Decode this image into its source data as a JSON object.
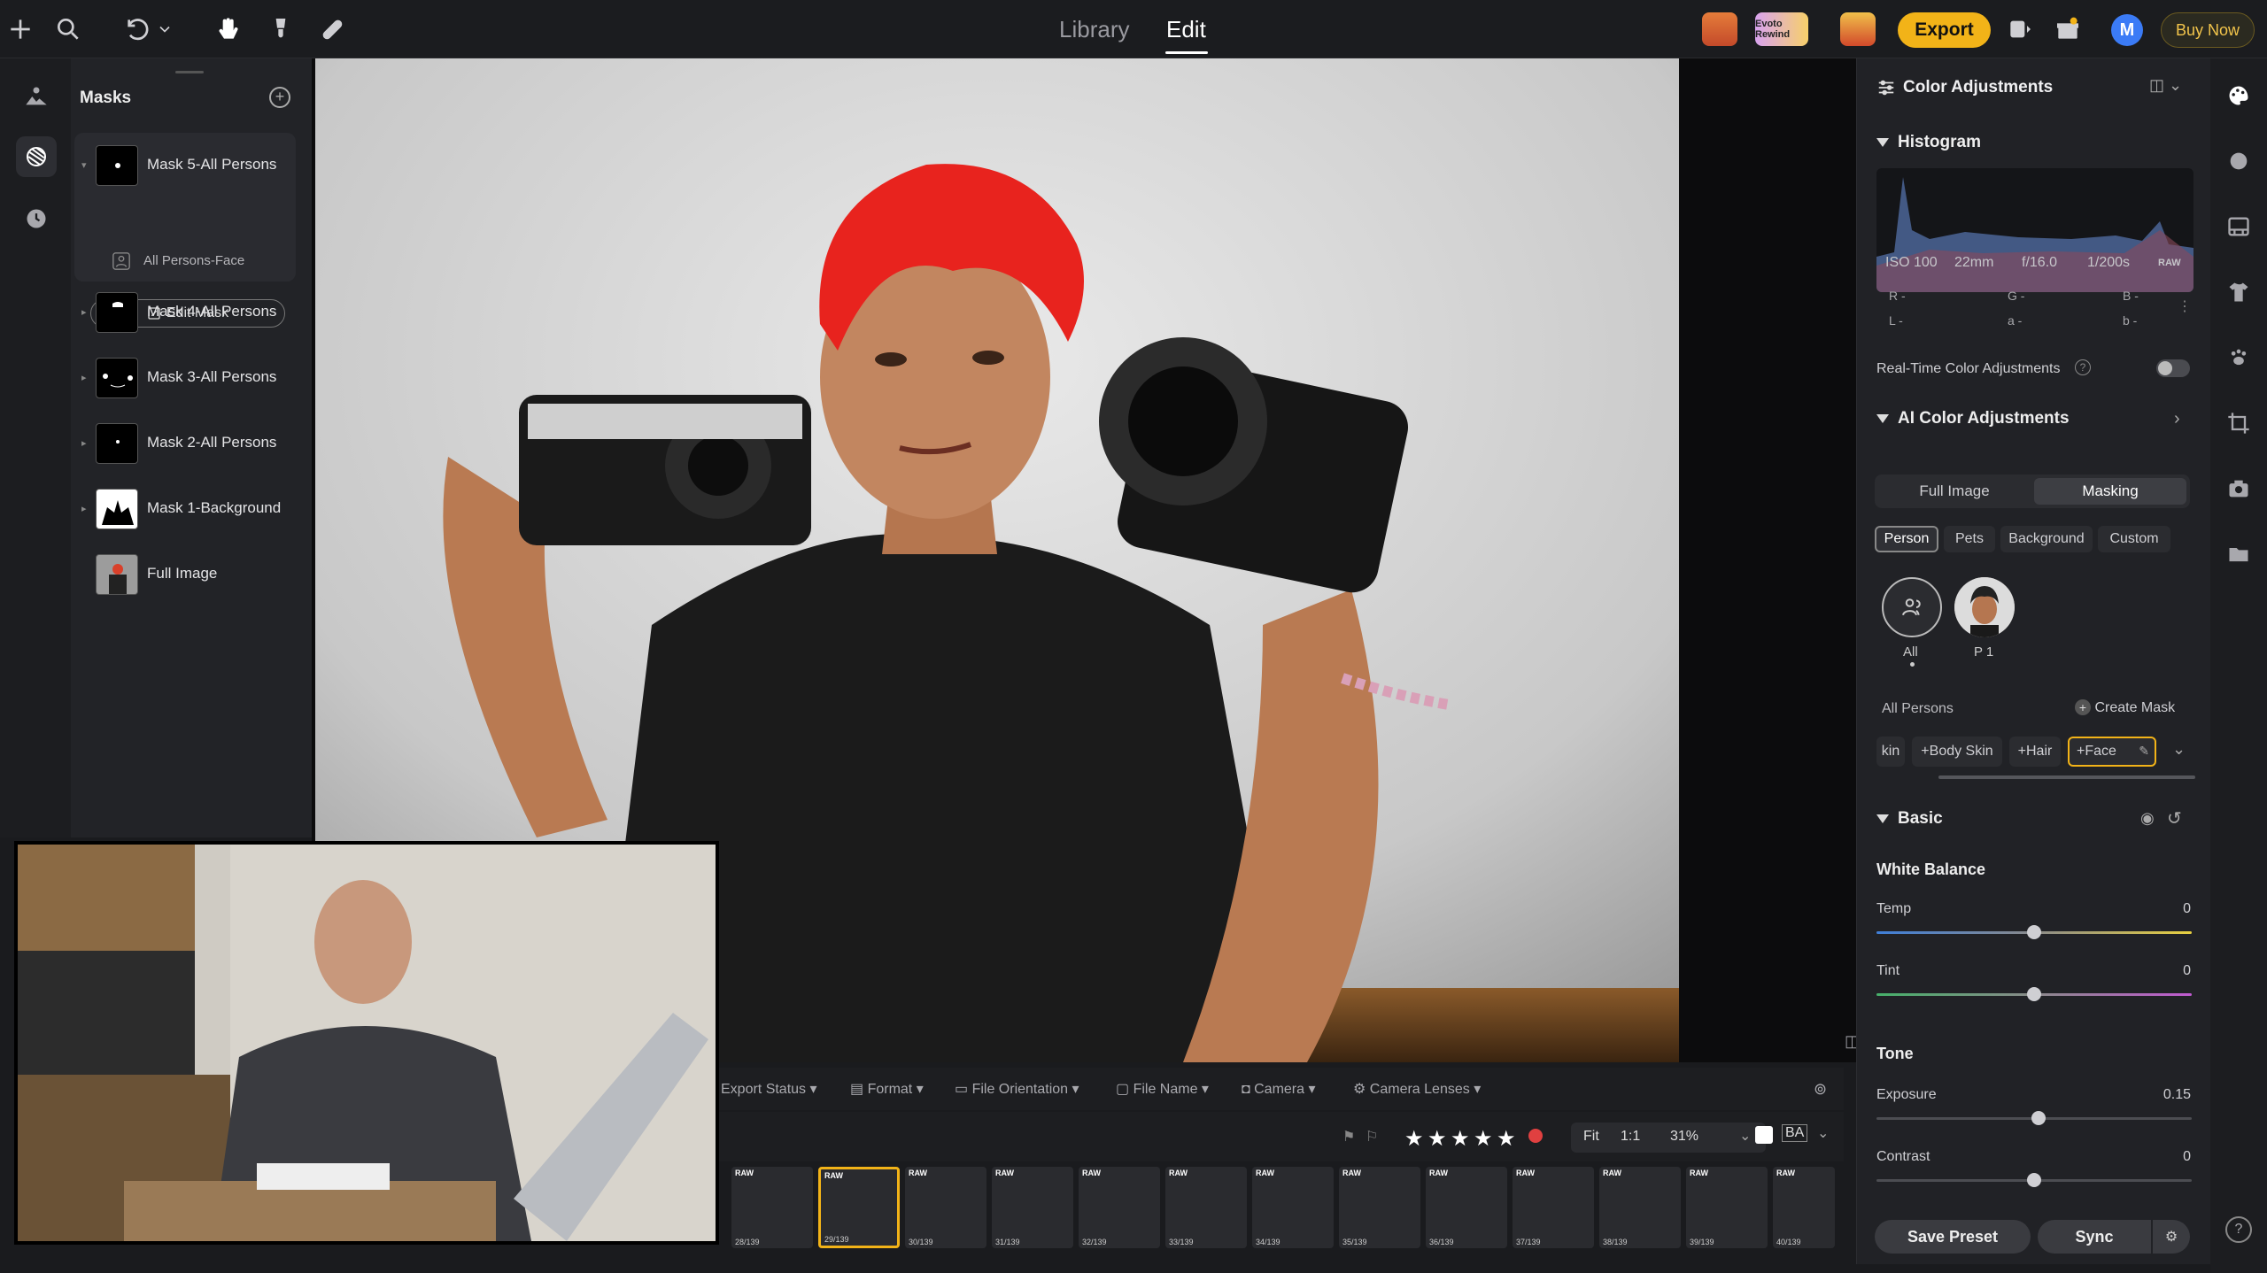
{
  "topbar": {
    "tabs": [
      "Library",
      "Edit"
    ],
    "active_tab": "Edit",
    "export_label": "Export",
    "avatar_initial": "M",
    "buy_now_label": "Buy Now",
    "promo_label": "Evoto Rewind",
    "accent_color": "#f2b318"
  },
  "masks": {
    "title": "Masks",
    "items": [
      {
        "label": "Mask 5-All Persons",
        "sub": "All Persons-Face",
        "edit_label": "Edit Mask"
      },
      {
        "label": "Mask 4-All Persons"
      },
      {
        "label": "Mask 3-All Persons"
      },
      {
        "label": "Mask 2-All Persons"
      },
      {
        "label": "Mask 1-Background"
      },
      {
        "label": "Full Image"
      }
    ]
  },
  "filters": [
    "Export Status",
    "Format",
    "File Orientation",
    "File Name",
    "Camera",
    "Camera Lenses"
  ],
  "view": {
    "fit": "Fit",
    "one_to_one": "1:1",
    "zoom": "31%",
    "rating_stars": 5
  },
  "filmstrip": [
    {
      "raw": "RAW",
      "num": "28/139"
    },
    {
      "raw": "RAW",
      "num": "29/139",
      "selected": true
    },
    {
      "raw": "RAW",
      "num": "30/139"
    },
    {
      "raw": "RAW",
      "num": "31/139"
    },
    {
      "raw": "RAW",
      "num": "32/139"
    },
    {
      "raw": "RAW",
      "num": "33/139"
    },
    {
      "raw": "RAW",
      "num": "34/139"
    },
    {
      "raw": "RAW",
      "num": "35/139"
    },
    {
      "raw": "RAW",
      "num": "36/139"
    },
    {
      "raw": "RAW",
      "num": "37/139"
    },
    {
      "raw": "RAW",
      "num": "38/139"
    },
    {
      "raw": "RAW",
      "num": "39/139"
    },
    {
      "raw": "RAW",
      "num": "40/139"
    }
  ],
  "right": {
    "title": "Color Adjustments",
    "histogram_title": "Histogram",
    "exif": {
      "iso": "ISO 100",
      "focal": "22mm",
      "aperture": "f/16.0",
      "shutter": "1/200s",
      "format": "RAW"
    },
    "rgb": {
      "r": "R -",
      "g": "G -",
      "b": "B -",
      "l": "L -",
      "a": "a -",
      "b2": "b -"
    },
    "realtime_label": "Real-Time Color Adjustments",
    "ai_title": "AI Color Adjustments",
    "segments": [
      "Full Image",
      "Masking"
    ],
    "active_segment": "Masking",
    "chips": [
      "Person",
      "Pets",
      "Background",
      "Custom"
    ],
    "active_chip": "Person",
    "persons": [
      {
        "label": "All"
      },
      {
        "label": "P 1"
      }
    ],
    "all_persons_label": "All Persons",
    "create_mask_label": "Create Mask",
    "tags": [
      "kin",
      "+Body Skin",
      "+Hair",
      "+Face"
    ],
    "basic_title": "Basic",
    "white_balance_title": "White Balance",
    "tone_title": "Tone",
    "sliders": {
      "temp": {
        "label": "Temp",
        "value": "0",
        "pos": 0.5
      },
      "tint": {
        "label": "Tint",
        "value": "0",
        "pos": 0.5
      },
      "exposure": {
        "label": "Exposure",
        "value": "0.15",
        "pos": 0.515
      },
      "contrast": {
        "label": "Contrast",
        "value": "0",
        "pos": 0.5
      }
    },
    "save_preset_label": "Save Preset",
    "sync_label": "Sync"
  }
}
